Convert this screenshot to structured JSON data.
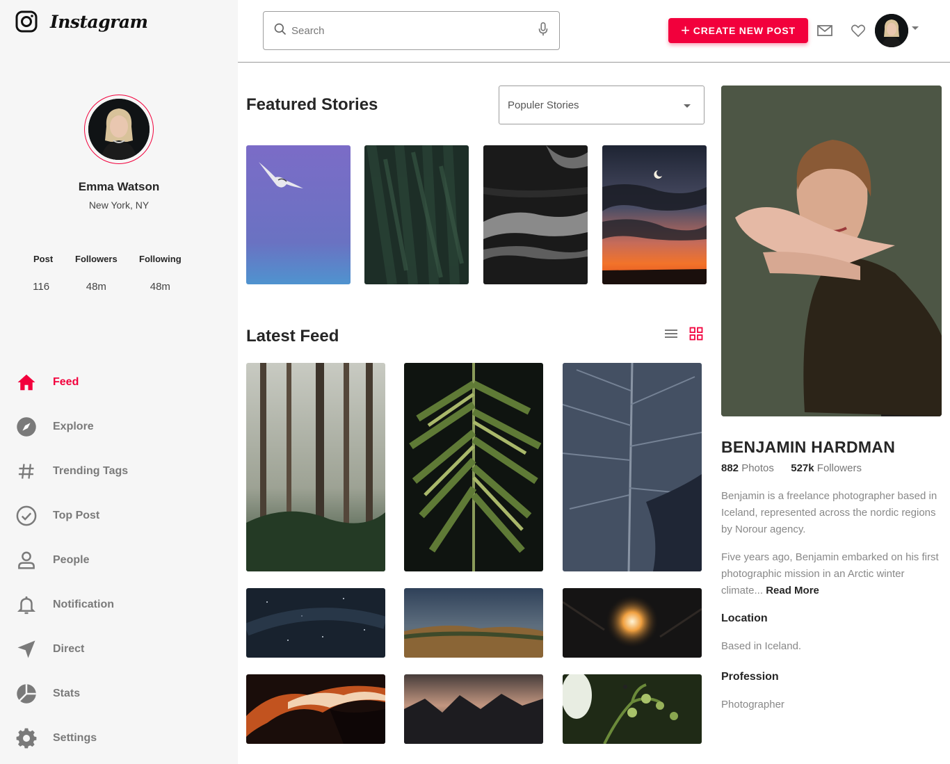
{
  "app": {
    "name": "Instagram"
  },
  "user": {
    "name": "Emma Watson",
    "location": "New York, NY"
  },
  "stats": [
    {
      "label": "Post",
      "value": "116"
    },
    {
      "label": "Followers",
      "value": "48m"
    },
    {
      "label": "Following",
      "value": "48m"
    }
  ],
  "nav": [
    {
      "label": "Feed",
      "icon": "home-icon",
      "active": true
    },
    {
      "label": "Explore",
      "icon": "compass-icon",
      "active": false
    },
    {
      "label": "Trending Tags",
      "icon": "hashtag-icon",
      "active": false
    },
    {
      "label": "Top Post",
      "icon": "check-circle-icon",
      "active": false
    },
    {
      "label": "People",
      "icon": "person-icon",
      "active": false
    },
    {
      "label": "Notification",
      "icon": "bell-icon",
      "active": false
    },
    {
      "label": "Direct",
      "icon": "send-icon",
      "active": false
    },
    {
      "label": "Stats",
      "icon": "pie-chart-icon",
      "active": false
    },
    {
      "label": "Settings",
      "icon": "gear-icon",
      "active": false
    }
  ],
  "header": {
    "search_placeholder": "Search",
    "create_label": "CREATE NEW POST"
  },
  "featured": {
    "title": "Featured Stories",
    "filter": "Populer Stories",
    "stories": [
      "seagull-sky",
      "pine-forest",
      "ocean-waves",
      "moon-sunset"
    ]
  },
  "feed": {
    "title": "Latest Feed",
    "items": [
      "misty-forest",
      "palm-leaf",
      "dark-leaf",
      "starry-sky",
      "dusky-hill",
      "glowing-lantern",
      "red-canyon",
      "mountain-dusk",
      "green-buds"
    ]
  },
  "profile_card": {
    "name": "BENJAMIN HARDMAN",
    "photos_count": "882",
    "photos_label": "Photos",
    "followers_count": "527k",
    "followers_label": "Followers",
    "bio1": "Benjamin is a freelance photographer based in Iceland, represented across the nordic regions by Norour agency.",
    "bio2": "Five years ago, Benjamin embarked on his first photographic mission in an Arctic winter climate...",
    "read_more": "Read More",
    "location_label": "Location",
    "location_value": "Based in Iceland.",
    "profession_label": "Profession",
    "profession_value": "Photographer"
  },
  "colors": {
    "accent": "#f2003c",
    "sidebar_bg": "#f6f6f6",
    "muted": "#7a7a7a"
  }
}
